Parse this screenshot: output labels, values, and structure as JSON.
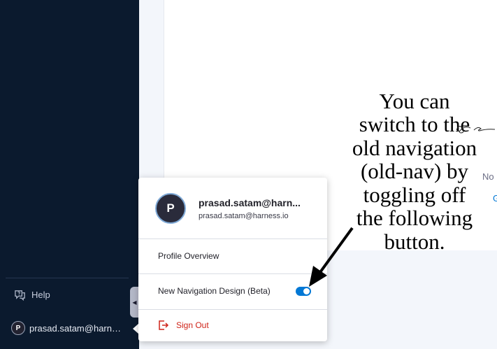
{
  "sidebar": {
    "help_label": "Help",
    "user_label": "prasad.satam@harne...",
    "user_initial": "P"
  },
  "background": {
    "partial_text_1": "No",
    "partial_text_2": "G"
  },
  "popover": {
    "avatar_initial": "P",
    "username": "prasad.satam@harn...",
    "email": "prasad.satam@harness.io",
    "profile_overview": "Profile Overview",
    "new_nav_label": "New Navigation Design (Beta)",
    "new_nav_enabled": true,
    "sign_out": "Sign Out"
  },
  "annotation": {
    "lines": [
      "You can",
      "switch to the",
      "old navigation",
      "(old-nav) by",
      "toggling off",
      "the following",
      "button."
    ]
  },
  "colors": {
    "sidebar_bg": "#0b1a2e",
    "accent_blue": "#0278d5",
    "danger_red": "#cf2318"
  },
  "icons": {
    "help": "help-icon",
    "sign_out": "sign-out-icon",
    "collapse": "chevron-left-icon"
  }
}
